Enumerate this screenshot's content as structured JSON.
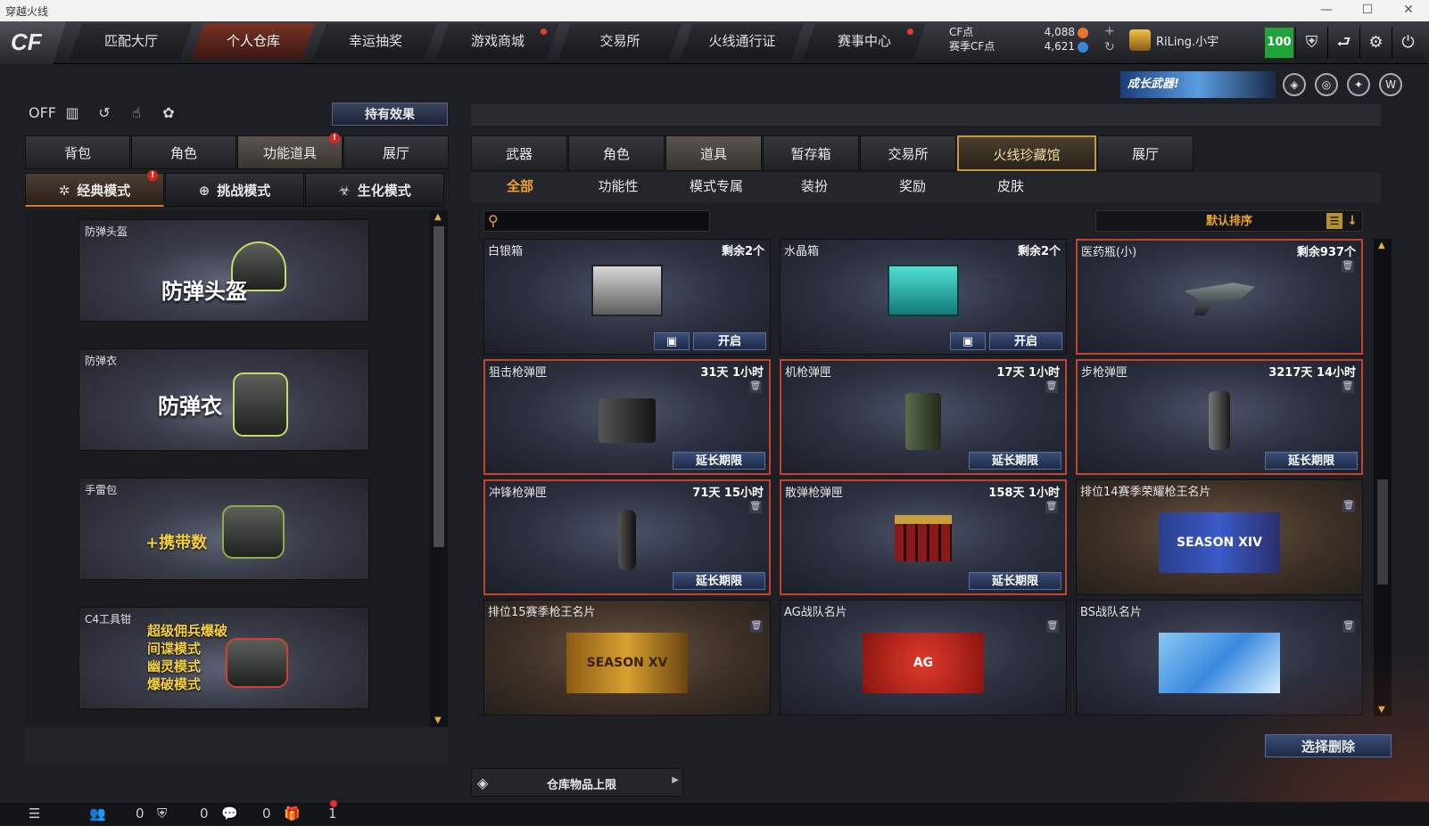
{
  "window": {
    "title": "穿越火线"
  },
  "nav": {
    "tabs": [
      {
        "label": "匹配大厅"
      },
      {
        "label": "个人仓库",
        "active": true
      },
      {
        "label": "幸运抽奖"
      },
      {
        "label": "游戏商城",
        "dot": true
      },
      {
        "label": "交易所"
      },
      {
        "label": "火线通行证"
      },
      {
        "label": "赛事中心",
        "dot": true
      }
    ],
    "cf_label": "CF点",
    "season_cf_label": "赛季CF点",
    "cf_value": "4,088",
    "season_cf_value": "4,621",
    "username": "RiLing.小宇",
    "level": "100",
    "logo": "CF"
  },
  "promo": {
    "label": "成长武器!"
  },
  "left": {
    "off_label": "OFF",
    "effect_button": "持有效果",
    "tabs": [
      "背包",
      "角色",
      "功能道具",
      "展厅"
    ],
    "modes": [
      "经典模式",
      "挑战模式",
      "生化模式"
    ],
    "items": [
      {
        "name": "防弹头盔",
        "big": "防弹头盔"
      },
      {
        "name": "防弹衣",
        "big": "防弹衣"
      },
      {
        "name": "手雷包",
        "big": "+携带数"
      },
      {
        "name": "C4工具钳",
        "lines": [
          "超级佣兵爆破",
          "间谍模式",
          "幽灵模式",
          "爆破模式"
        ]
      }
    ]
  },
  "right": {
    "tabs": [
      "武器",
      "角色",
      "道具",
      "暂存箱",
      "交易所",
      "火线珍藏馆",
      "展厅"
    ],
    "subtabs": [
      "全部",
      "功能性",
      "模式专属",
      "装扮",
      "奖励",
      "皮肤"
    ],
    "search_placeholder": "",
    "sort_label": "默认排序",
    "open_label": "开启",
    "extend_label": "延长期限",
    "cards": [
      {
        "name": "白银箱",
        "status": "剩余2个"
      },
      {
        "name": "水晶箱",
        "status": "剩余2个"
      },
      {
        "name": "医药瓶(小)",
        "status": "剩余937个"
      },
      {
        "name": "狙击枪弹匣",
        "status": "31天 1小时"
      },
      {
        "name": "机枪弹匣",
        "status": "17天 1小时"
      },
      {
        "name": "步枪弹匣",
        "status": "3217天 14小时"
      },
      {
        "name": "冲锋枪弹匣",
        "status": "71天 15小时"
      },
      {
        "name": "散弹枪弹匣",
        "status": "158天 1小时"
      },
      {
        "name": "排位14赛季荣耀枪王名片",
        "status": "",
        "card_text": "SEASON XIV"
      },
      {
        "name": "排位15赛季枪王名片",
        "status": "",
        "card_text": "SEASON XV"
      },
      {
        "name": "AG战队名片",
        "status": "",
        "card_text": "AG"
      },
      {
        "name": "BS战队名片",
        "status": "",
        "card_text": ""
      }
    ],
    "delete_button": "选择删除",
    "storage_label": "仓库物品上限"
  },
  "bottom": {
    "count1": "0",
    "count2": "0",
    "count3": "0",
    "count4": "1"
  }
}
